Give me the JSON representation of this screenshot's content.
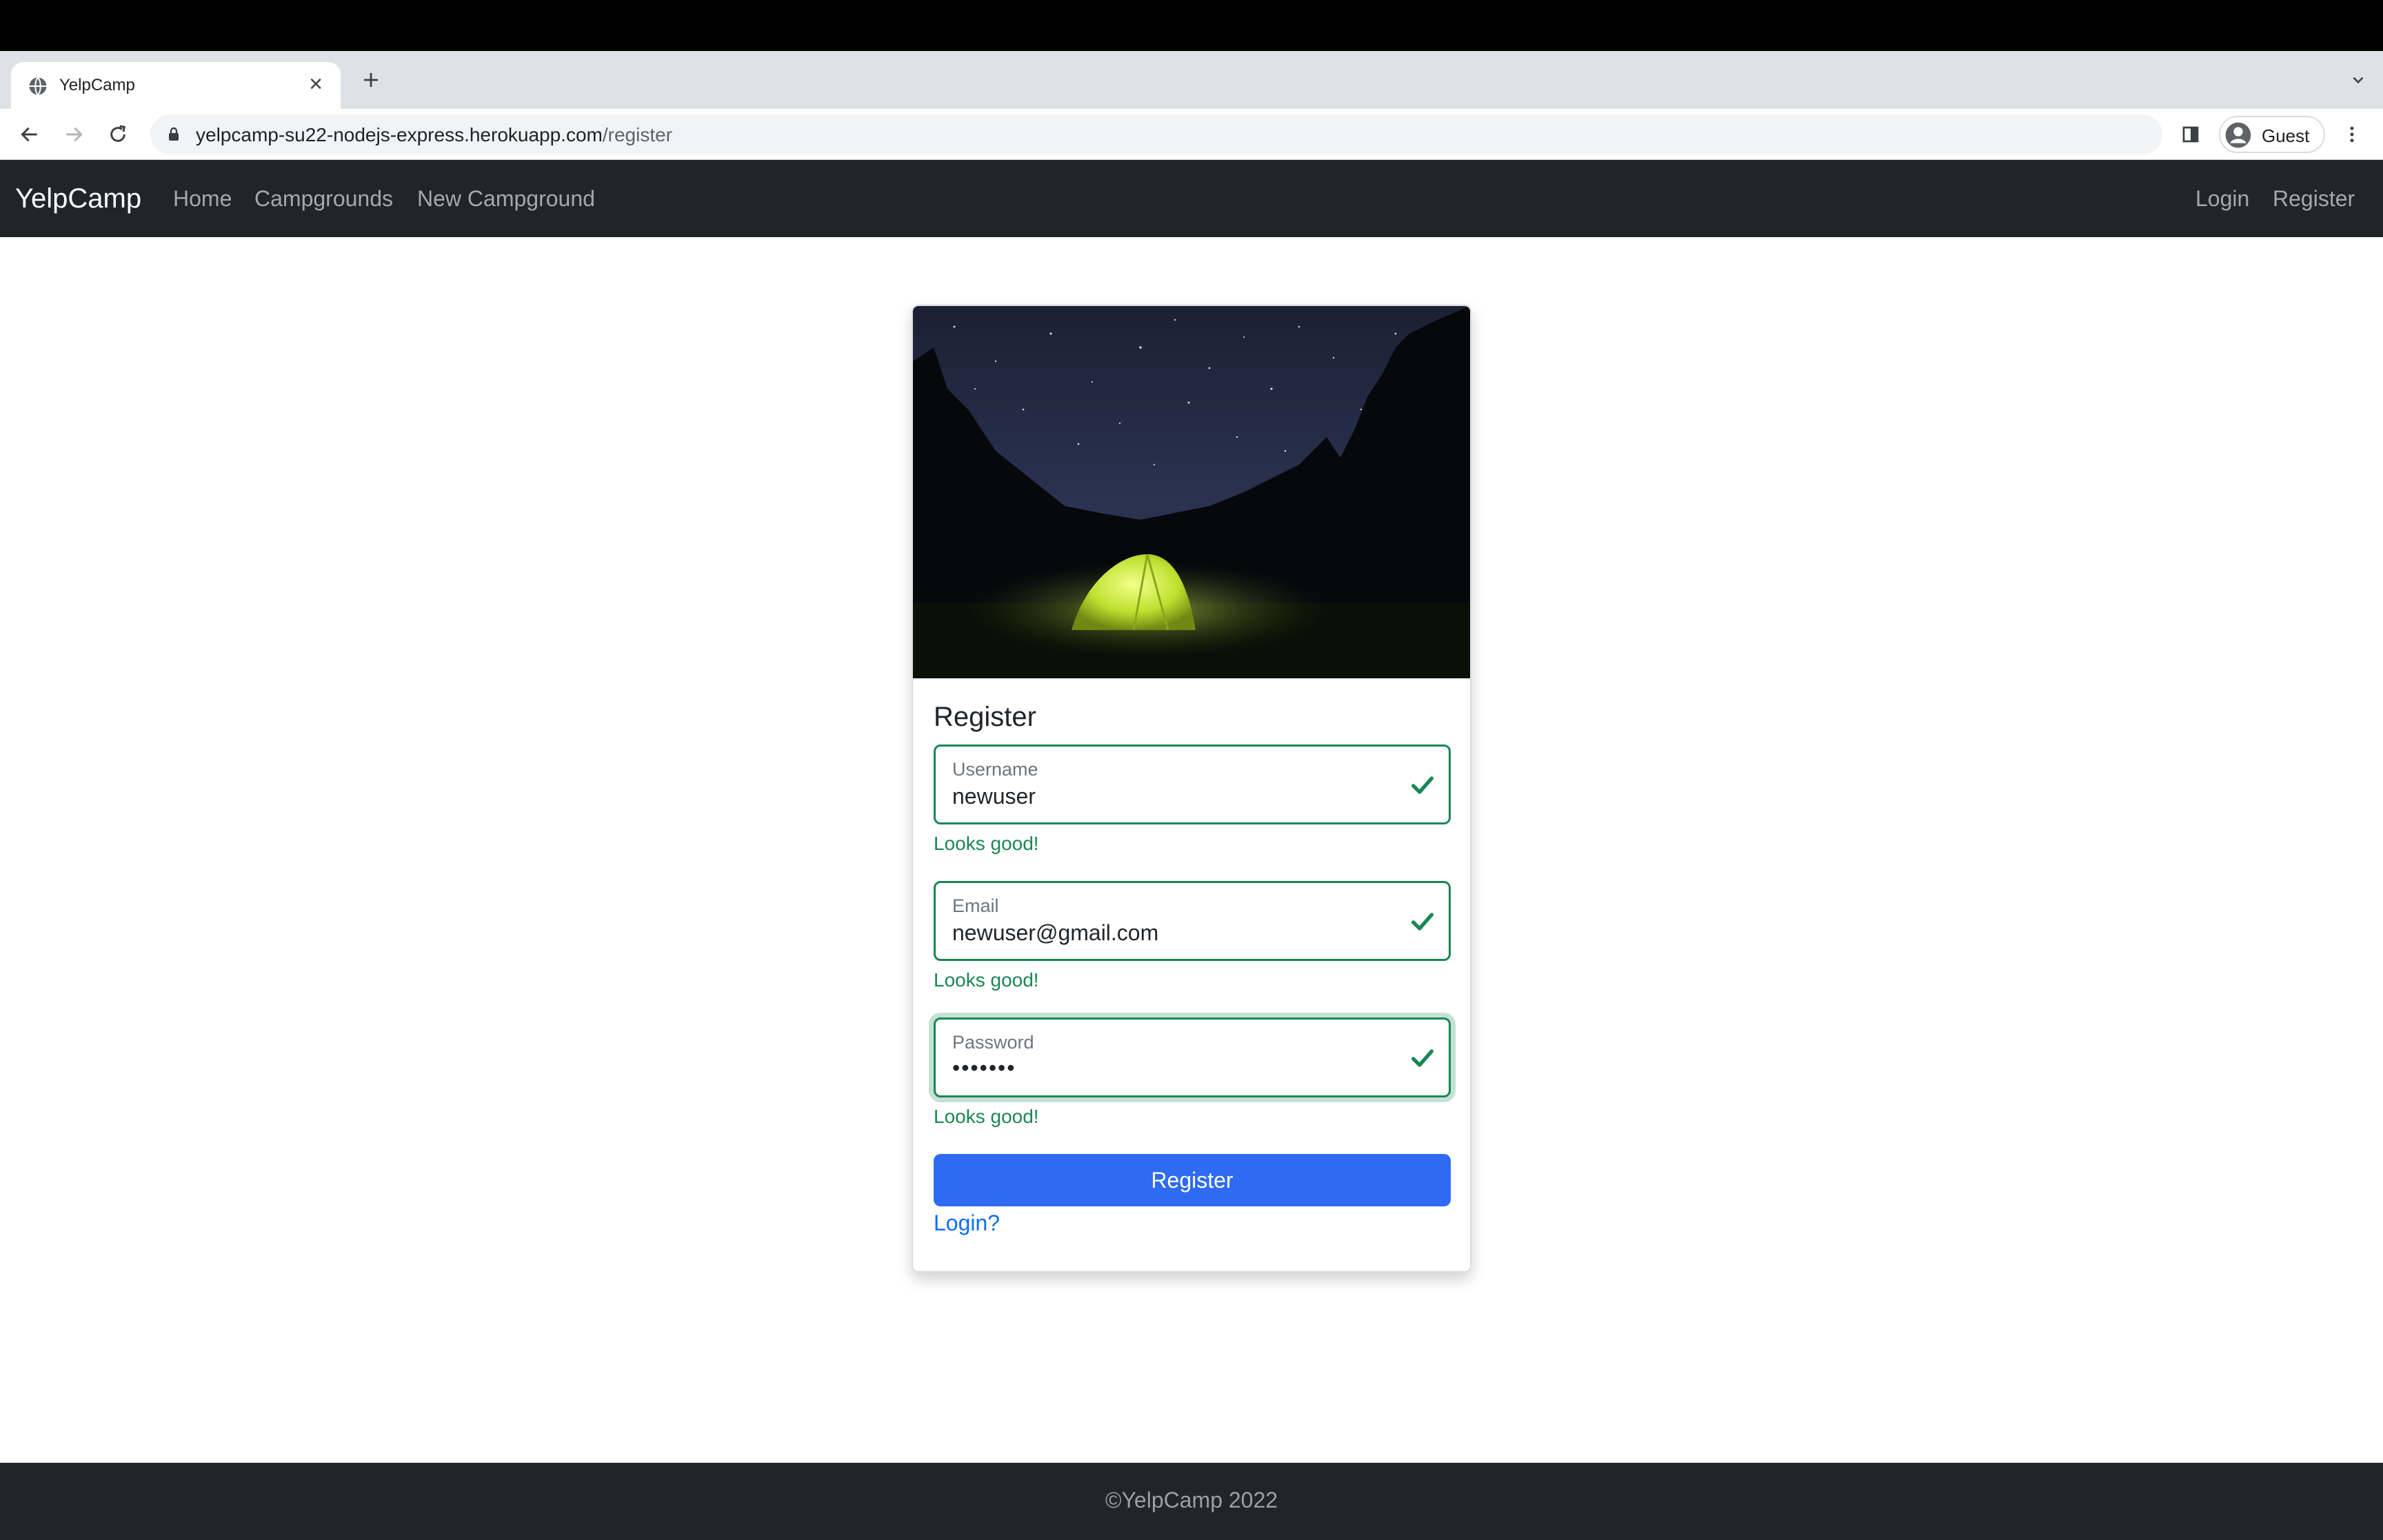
{
  "browser": {
    "tab": {
      "title": "YelpCamp",
      "favicon": "globe-icon",
      "close_icon": "close-icon"
    },
    "new_tab_icon": "plus-icon",
    "tab_list_icon": "chevron-down-icon",
    "nav": {
      "back_icon": "arrow-left-icon",
      "forward_icon": "arrow-right-icon",
      "reload_icon": "reload-icon"
    },
    "url": {
      "host": "yelpcamp-su22-nodejs-express.herokuapp.com",
      "path": "/register"
    },
    "profile": {
      "name": "Guest"
    }
  },
  "navbar": {
    "brand": "YelpCamp",
    "left_links": [
      "Home",
      "Campgrounds",
      "New Campground"
    ],
    "right_links": [
      "Login",
      "Register"
    ]
  },
  "register": {
    "title": "Register",
    "image_alt": "tent-under-night-sky-image",
    "fields": [
      {
        "label": "Username",
        "value": "newuser",
        "feedback": "Looks good!"
      },
      {
        "label": "Email",
        "value": "newuser@gmail.com",
        "feedback": "Looks good!"
      },
      {
        "label": "Password",
        "value": "•••••••",
        "feedback": "Looks good!"
      }
    ],
    "submit_label": "Register",
    "login_link": "Login?"
  },
  "footer": {
    "text": "©YelpCamp 2022"
  },
  "colors": {
    "navbar_bg": "#212529",
    "valid_green": "#198754",
    "primary_button": "#2f6bf2",
    "link_blue": "#0d6efd"
  }
}
